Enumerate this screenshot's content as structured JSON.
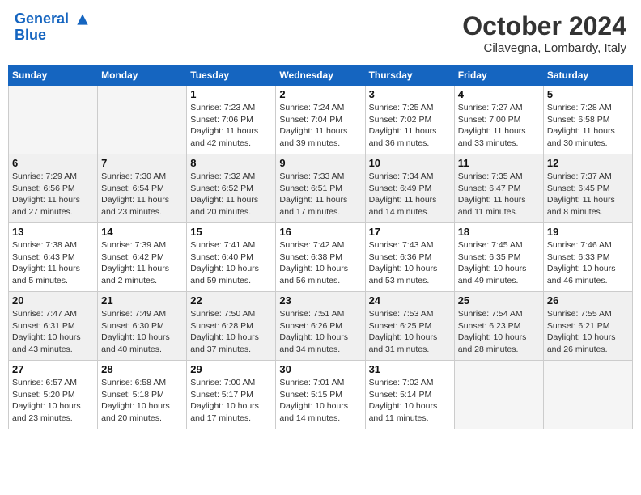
{
  "header": {
    "logo_line1": "General",
    "logo_line2": "Blue",
    "month": "October 2024",
    "location": "Cilavegna, Lombardy, Italy"
  },
  "weekdays": [
    "Sunday",
    "Monday",
    "Tuesday",
    "Wednesday",
    "Thursday",
    "Friday",
    "Saturday"
  ],
  "weeks": [
    [
      {
        "day": "",
        "sunrise": "",
        "sunset": "",
        "daylight": "",
        "empty": true
      },
      {
        "day": "",
        "sunrise": "",
        "sunset": "",
        "daylight": "",
        "empty": true
      },
      {
        "day": "1",
        "sunrise": "Sunrise: 7:23 AM",
        "sunset": "Sunset: 7:06 PM",
        "daylight": "Daylight: 11 hours and 42 minutes."
      },
      {
        "day": "2",
        "sunrise": "Sunrise: 7:24 AM",
        "sunset": "Sunset: 7:04 PM",
        "daylight": "Daylight: 11 hours and 39 minutes."
      },
      {
        "day": "3",
        "sunrise": "Sunrise: 7:25 AM",
        "sunset": "Sunset: 7:02 PM",
        "daylight": "Daylight: 11 hours and 36 minutes."
      },
      {
        "day": "4",
        "sunrise": "Sunrise: 7:27 AM",
        "sunset": "Sunset: 7:00 PM",
        "daylight": "Daylight: 11 hours and 33 minutes."
      },
      {
        "day": "5",
        "sunrise": "Sunrise: 7:28 AM",
        "sunset": "Sunset: 6:58 PM",
        "daylight": "Daylight: 11 hours and 30 minutes."
      }
    ],
    [
      {
        "day": "6",
        "sunrise": "Sunrise: 7:29 AM",
        "sunset": "Sunset: 6:56 PM",
        "daylight": "Daylight: 11 hours and 27 minutes."
      },
      {
        "day": "7",
        "sunrise": "Sunrise: 7:30 AM",
        "sunset": "Sunset: 6:54 PM",
        "daylight": "Daylight: 11 hours and 23 minutes."
      },
      {
        "day": "8",
        "sunrise": "Sunrise: 7:32 AM",
        "sunset": "Sunset: 6:52 PM",
        "daylight": "Daylight: 11 hours and 20 minutes."
      },
      {
        "day": "9",
        "sunrise": "Sunrise: 7:33 AM",
        "sunset": "Sunset: 6:51 PM",
        "daylight": "Daylight: 11 hours and 17 minutes."
      },
      {
        "day": "10",
        "sunrise": "Sunrise: 7:34 AM",
        "sunset": "Sunset: 6:49 PM",
        "daylight": "Daylight: 11 hours and 14 minutes."
      },
      {
        "day": "11",
        "sunrise": "Sunrise: 7:35 AM",
        "sunset": "Sunset: 6:47 PM",
        "daylight": "Daylight: 11 hours and 11 minutes."
      },
      {
        "day": "12",
        "sunrise": "Sunrise: 7:37 AM",
        "sunset": "Sunset: 6:45 PM",
        "daylight": "Daylight: 11 hours and 8 minutes."
      }
    ],
    [
      {
        "day": "13",
        "sunrise": "Sunrise: 7:38 AM",
        "sunset": "Sunset: 6:43 PM",
        "daylight": "Daylight: 11 hours and 5 minutes."
      },
      {
        "day": "14",
        "sunrise": "Sunrise: 7:39 AM",
        "sunset": "Sunset: 6:42 PM",
        "daylight": "Daylight: 11 hours and 2 minutes."
      },
      {
        "day": "15",
        "sunrise": "Sunrise: 7:41 AM",
        "sunset": "Sunset: 6:40 PM",
        "daylight": "Daylight: 10 hours and 59 minutes."
      },
      {
        "day": "16",
        "sunrise": "Sunrise: 7:42 AM",
        "sunset": "Sunset: 6:38 PM",
        "daylight": "Daylight: 10 hours and 56 minutes."
      },
      {
        "day": "17",
        "sunrise": "Sunrise: 7:43 AM",
        "sunset": "Sunset: 6:36 PM",
        "daylight": "Daylight: 10 hours and 53 minutes."
      },
      {
        "day": "18",
        "sunrise": "Sunrise: 7:45 AM",
        "sunset": "Sunset: 6:35 PM",
        "daylight": "Daylight: 10 hours and 49 minutes."
      },
      {
        "day": "19",
        "sunrise": "Sunrise: 7:46 AM",
        "sunset": "Sunset: 6:33 PM",
        "daylight": "Daylight: 10 hours and 46 minutes."
      }
    ],
    [
      {
        "day": "20",
        "sunrise": "Sunrise: 7:47 AM",
        "sunset": "Sunset: 6:31 PM",
        "daylight": "Daylight: 10 hours and 43 minutes."
      },
      {
        "day": "21",
        "sunrise": "Sunrise: 7:49 AM",
        "sunset": "Sunset: 6:30 PM",
        "daylight": "Daylight: 10 hours and 40 minutes."
      },
      {
        "day": "22",
        "sunrise": "Sunrise: 7:50 AM",
        "sunset": "Sunset: 6:28 PM",
        "daylight": "Daylight: 10 hours and 37 minutes."
      },
      {
        "day": "23",
        "sunrise": "Sunrise: 7:51 AM",
        "sunset": "Sunset: 6:26 PM",
        "daylight": "Daylight: 10 hours and 34 minutes."
      },
      {
        "day": "24",
        "sunrise": "Sunrise: 7:53 AM",
        "sunset": "Sunset: 6:25 PM",
        "daylight": "Daylight: 10 hours and 31 minutes."
      },
      {
        "day": "25",
        "sunrise": "Sunrise: 7:54 AM",
        "sunset": "Sunset: 6:23 PM",
        "daylight": "Daylight: 10 hours and 28 minutes."
      },
      {
        "day": "26",
        "sunrise": "Sunrise: 7:55 AM",
        "sunset": "Sunset: 6:21 PM",
        "daylight": "Daylight: 10 hours and 26 minutes."
      }
    ],
    [
      {
        "day": "27",
        "sunrise": "Sunrise: 6:57 AM",
        "sunset": "Sunset: 5:20 PM",
        "daylight": "Daylight: 10 hours and 23 minutes."
      },
      {
        "day": "28",
        "sunrise": "Sunrise: 6:58 AM",
        "sunset": "Sunset: 5:18 PM",
        "daylight": "Daylight: 10 hours and 20 minutes."
      },
      {
        "day": "29",
        "sunrise": "Sunrise: 7:00 AM",
        "sunset": "Sunset: 5:17 PM",
        "daylight": "Daylight: 10 hours and 17 minutes."
      },
      {
        "day": "30",
        "sunrise": "Sunrise: 7:01 AM",
        "sunset": "Sunset: 5:15 PM",
        "daylight": "Daylight: 10 hours and 14 minutes."
      },
      {
        "day": "31",
        "sunrise": "Sunrise: 7:02 AM",
        "sunset": "Sunset: 5:14 PM",
        "daylight": "Daylight: 10 hours and 11 minutes."
      },
      {
        "day": "",
        "sunrise": "",
        "sunset": "",
        "daylight": "",
        "empty": true
      },
      {
        "day": "",
        "sunrise": "",
        "sunset": "",
        "daylight": "",
        "empty": true
      }
    ]
  ]
}
